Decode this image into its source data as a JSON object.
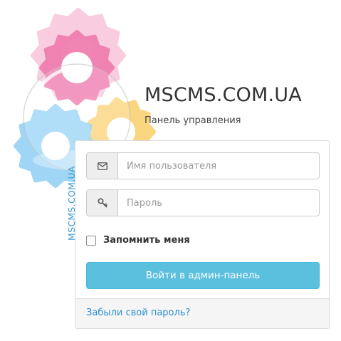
{
  "brand": {
    "title": "MSCMS.COM.UA",
    "subtitle": "Панель управления",
    "vertical_text": "MSCMS.COM.UA"
  },
  "login_form": {
    "username": {
      "placeholder": "Имя пользователя",
      "value": "",
      "icon": "envelope-icon"
    },
    "password": {
      "placeholder": "Пароль",
      "value": "",
      "icon": "key-icon"
    },
    "remember_label": "Запомнить меня",
    "remember_checked": false,
    "submit_label": "Войти в админ-панель",
    "forgot_link": "Забыли свой пароль?"
  },
  "colors": {
    "gear_pink_light": "#f9c8dc",
    "gear_pink": "#f07fb0",
    "gear_blue": "#8fd0f5",
    "gear_yellow": "#fbcf6a",
    "button": "#5bc0de",
    "link": "#2a8fd3"
  }
}
